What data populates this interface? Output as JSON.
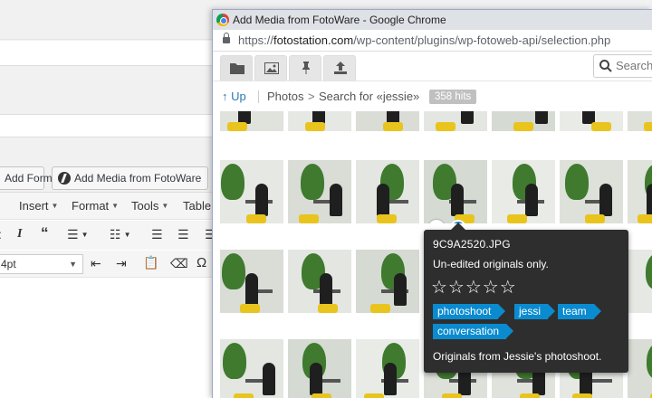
{
  "editor": {
    "add_form_label": "Add Form",
    "add_media_label": "Add Media from FotoWare",
    "menus": [
      "Insert",
      "Format",
      "Tools",
      "Table"
    ],
    "font_size": "4pt"
  },
  "window": {
    "title": "Add Media from FotoWare - Google Chrome",
    "url_scheme": "https://",
    "url_host": "fotostation.com",
    "url_path": "/wp-content/plugins/wp-fotoweb-api/selection.php",
    "tabs": [
      "folder-icon",
      "image-icon",
      "pin-icon",
      "upload-icon"
    ],
    "search_placeholder": "Search"
  },
  "breadcrumb": {
    "up_label": "Up",
    "photos": "Photos",
    "separator": ">",
    "search_label": "Search for «jessie»",
    "hits": "358 hits"
  },
  "tooltip": {
    "filename": "9C9A2520.JPG",
    "status": "Un-edited originals only.",
    "rating": 0,
    "rating_max": 5,
    "stars": "☆☆☆☆☆",
    "tags": [
      "photoshoot",
      "jessi",
      "team",
      "conversation"
    ],
    "description": "Originals from Jessie's photoshoot."
  },
  "colors": {
    "accent": "#0a8bd0",
    "tooltip_bg": "#2e2e2e",
    "chair": "#e9c41c",
    "plant": "#3f7a2f"
  }
}
